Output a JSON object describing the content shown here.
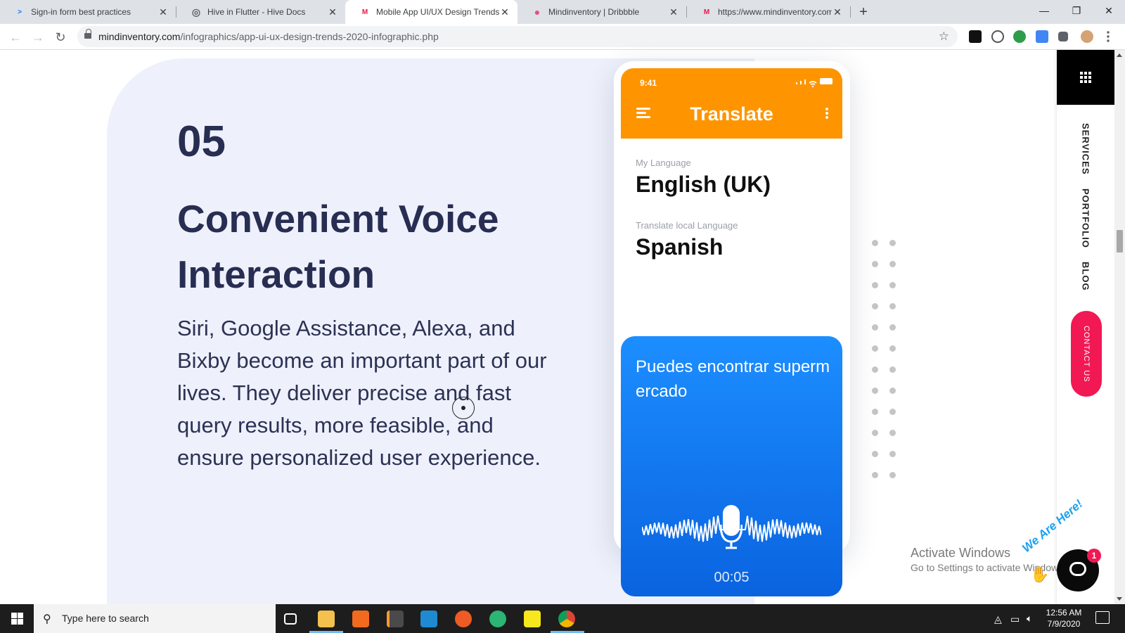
{
  "browser": {
    "tabs": [
      {
        "title": "Sign-in form best practices",
        "favicon": "web-dev-icon",
        "color": "#1a73e8",
        "glyph": ">"
      },
      {
        "title": "Hive in Flutter - Hive Docs",
        "favicon": "globe-icon",
        "color": "#5f6368",
        "glyph": "◎"
      },
      {
        "title": "Mobile App UI/UX Design Trends",
        "favicon": "mindinventory-icon",
        "color": "#e8174c",
        "glyph": "M"
      },
      {
        "title": "Mindinventory | Dribbble",
        "favicon": "dribbble-icon",
        "color": "#ea4c89",
        "glyph": "●"
      },
      {
        "title": "https://www.mindinventory.com/",
        "favicon": "mindinventory-icon",
        "color": "#e8174c",
        "glyph": "M"
      }
    ],
    "active_tab": 2,
    "new_tab_label": "+",
    "window_controls": {
      "minimize": "—",
      "maximize": "❐",
      "close": "✕"
    },
    "nav": {
      "back": "←",
      "forward": "→",
      "reload": "↻"
    },
    "url_domain": "mindinventory.com",
    "url_path": "/infographics/app-ui-ux-design-trends-2020-infographic.php",
    "bookmark_icon": "☆",
    "extensions": [
      "notion-icon",
      "wordpress-icon",
      "earth-icon",
      "translate-icon",
      "puzzle-icon",
      "profile-avatar",
      "more-icon"
    ]
  },
  "section": {
    "number": "05",
    "heading": "Convenient Voice Interaction",
    "body": "Siri, Google Assistance, Alexa, and Bixby become an important part of our lives. They deliver precise and fast query results, more feasible, and ensure personalized user experience."
  },
  "phone": {
    "status_time": "9:41",
    "app_title": "Translate",
    "my_language_label": "My Language",
    "my_language": "English (UK)",
    "target_language_label": "Translate local Language",
    "target_language": "Spanish",
    "transcript": "Puedes encontrar supermercado",
    "timer": "00:05",
    "accent_color": "#fe9500",
    "voice_card_color": "#1c8eff"
  },
  "sidebar": {
    "links": [
      "SERVICES",
      "PORTFOLIO",
      "BLOG"
    ],
    "contact": "CONTACT US",
    "contact_color": "#f21854"
  },
  "overlay": {
    "activate_title": "Activate Windows",
    "activate_sub": "Go to Settings to activate Windows.",
    "chat_badge": "1",
    "chat_tagline": "We Are Here!"
  },
  "taskbar": {
    "search_placeholder": "Type here to search",
    "time": "12:56 AM",
    "date": "7/9/2020",
    "apps": [
      "task-view-icon",
      "file-explorer-icon",
      "xampp-icon",
      "sublime-text-icon",
      "vscode-icon",
      "postman-icon",
      "chatgpt-like-icon",
      "sticky-notes-icon",
      "chrome-icon"
    ]
  }
}
